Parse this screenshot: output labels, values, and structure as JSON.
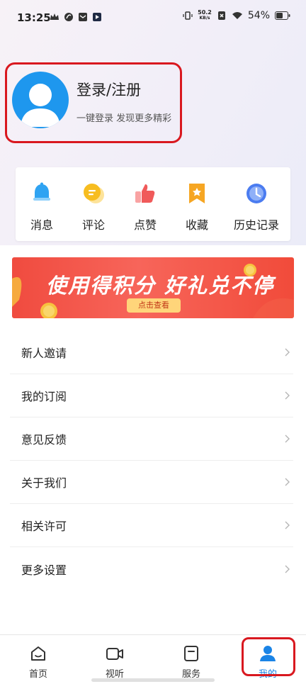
{
  "status_bar": {
    "time": "13:25",
    "net_speed_value": "50.2",
    "net_speed_unit": "KB/s",
    "battery": "54%"
  },
  "profile": {
    "title": "登录/注册",
    "subtitle": "一键登录 发现更多精彩"
  },
  "quick_actions": [
    {
      "label": "消息",
      "icon": "bell-icon",
      "color": "#2fa3f2"
    },
    {
      "label": "评论",
      "icon": "comment-icon",
      "color": "#f7bd20"
    },
    {
      "label": "点赞",
      "icon": "thumbs-up-icon",
      "color": "#f05a5a"
    },
    {
      "label": "收藏",
      "icon": "favorite-bookmark-icon",
      "color": "#f6a623"
    },
    {
      "label": "历史记录",
      "icon": "clock-icon",
      "color": "#4b7cf0"
    }
  ],
  "banner": {
    "title": "使用得积分 好礼兑不停",
    "button": "点击查看"
  },
  "menu": [
    {
      "label": "新人邀请"
    },
    {
      "label": "我的订阅"
    },
    {
      "label": "意见反馈"
    },
    {
      "label": "关于我们"
    },
    {
      "label": "相关许可"
    },
    {
      "label": "更多设置"
    }
  ],
  "bottom_nav": [
    {
      "label": "首页",
      "icon": "home-icon"
    },
    {
      "label": "视听",
      "icon": "video-icon"
    },
    {
      "label": "服务",
      "icon": "service-bookmark-icon"
    },
    {
      "label": "我的",
      "icon": "user-icon",
      "active": true
    }
  ],
  "colors": {
    "accent": "#1a84e6",
    "highlight": "#d9181f",
    "avatar_bg": "#1e97ee"
  }
}
